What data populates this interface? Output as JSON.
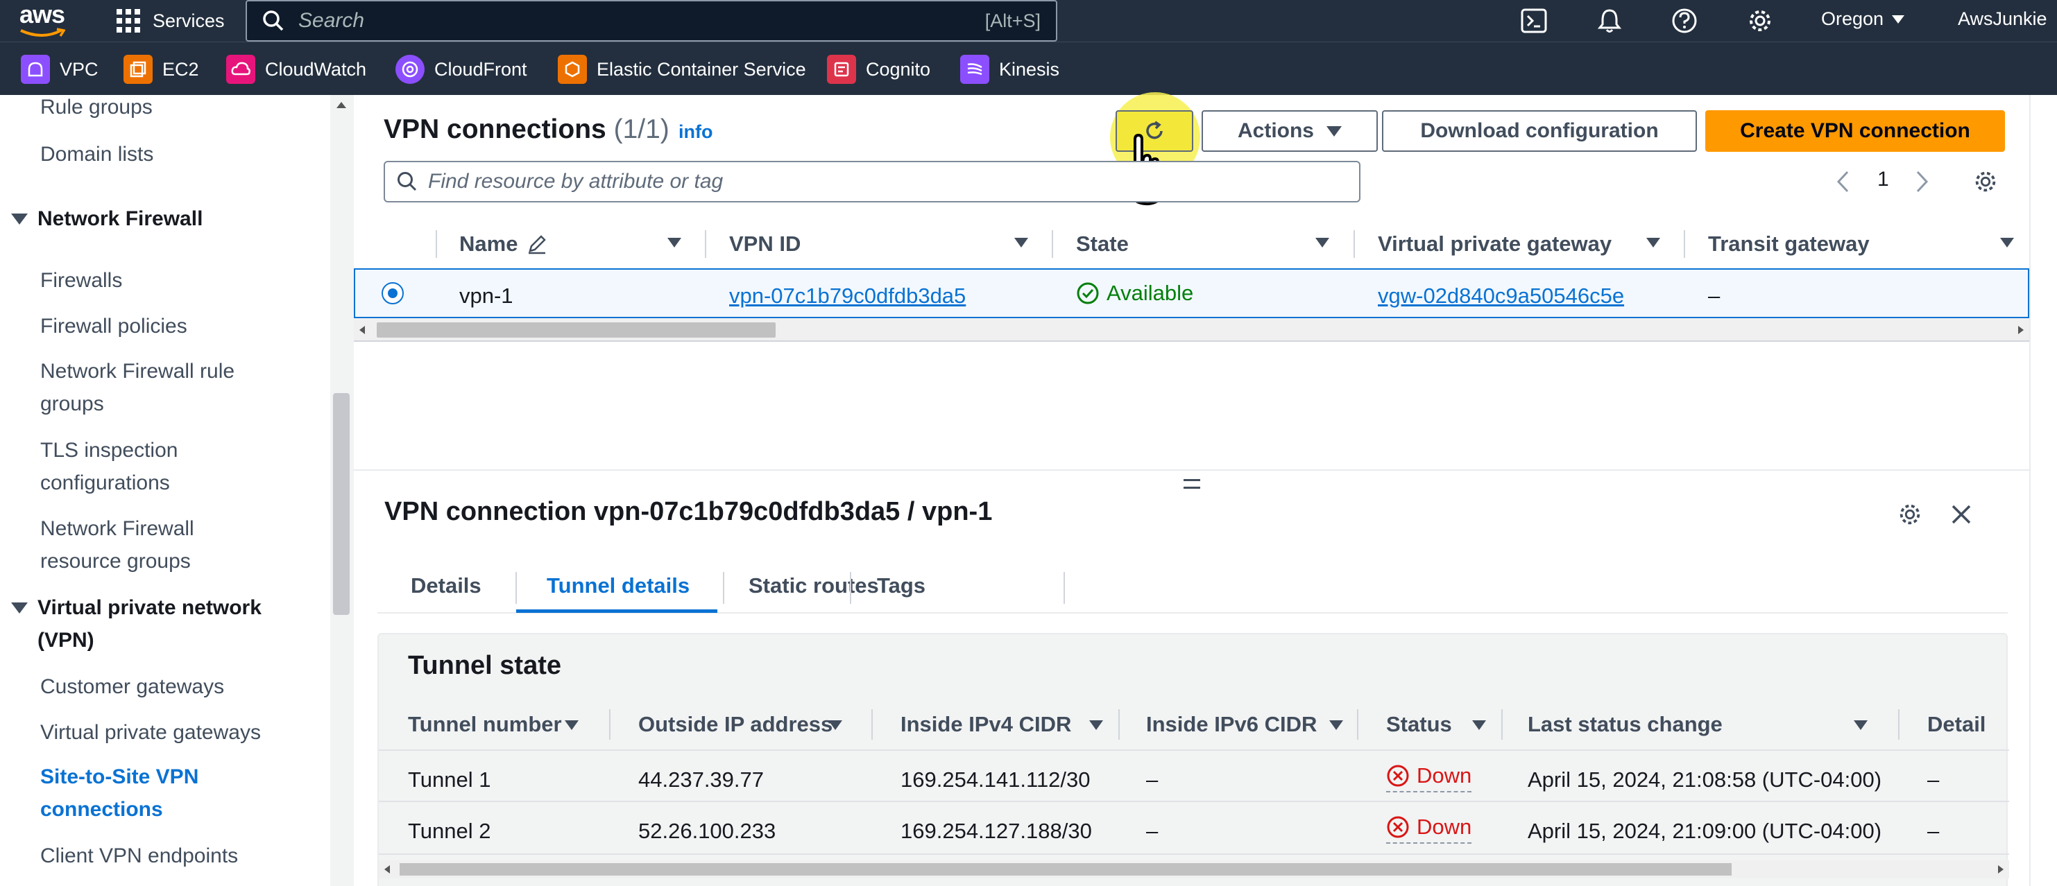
{
  "topbar": {
    "logo": "aws",
    "services_label": "Services",
    "search_placeholder": "Search",
    "search_shortcut": "[Alt+S]",
    "region": "Oregon",
    "account": "AwsJunkie"
  },
  "favorites": [
    {
      "label": "VPC",
      "icon": "vpc-icon",
      "color": "#8c4fff"
    },
    {
      "label": "EC2",
      "icon": "ec2-icon",
      "color": "#ed7100"
    },
    {
      "label": "CloudWatch",
      "icon": "cloudwatch-icon",
      "color": "#e7157b"
    },
    {
      "label": "CloudFront",
      "icon": "cloudfront-icon",
      "color": "#8c4fff"
    },
    {
      "label": "Elastic Container Service",
      "icon": "ecs-icon",
      "color": "#ed7100"
    },
    {
      "label": "Cognito",
      "icon": "cognito-icon",
      "color": "#dd344c"
    },
    {
      "label": "Kinesis",
      "icon": "kinesis-icon",
      "color": "#8c4fff"
    }
  ],
  "sidebar": {
    "items_top": [
      "Rule groups",
      "Domain lists"
    ],
    "section_firewall": "Network Firewall",
    "firewall_items": [
      "Firewalls",
      "Firewall policies",
      "Network Firewall rule groups",
      "TLS inspection configurations",
      "Network Firewall resource groups"
    ],
    "section_vpn": "Virtual private network (VPN)",
    "vpn_items": [
      "Customer gateways",
      "Virtual private gateways",
      "Site-to-Site VPN connections",
      "Client VPN endpoints"
    ]
  },
  "list": {
    "title": "VPN connections",
    "count": "(1/1)",
    "info": "info",
    "actions_label": "Actions",
    "download_label": "Download configuration",
    "create_label": "Create VPN connection",
    "filter_placeholder": "Find resource by attribute or tag",
    "page": "1",
    "columns": [
      "Name",
      "VPN ID",
      "State",
      "Virtual private gateway",
      "Transit gateway"
    ],
    "row": {
      "name": "vpn-1",
      "vpn_id": "vpn-07c1b79c0dfdb3da5",
      "state": "Available",
      "vgw": "vgw-02d840c9a50546c5e",
      "transit": "–"
    }
  },
  "detail": {
    "title": "VPN connection vpn-07c1b79c0dfdb3da5 / vpn-1",
    "tabs": [
      "Details",
      "Tunnel details",
      "Static routes",
      "Tags"
    ],
    "active_tab": "Tunnel details",
    "card_title": "Tunnel state",
    "columns": [
      "Tunnel number",
      "Outside IP address",
      "Inside IPv4 CIDR",
      "Inside IPv6 CIDR",
      "Status",
      "Last status change",
      "Detail"
    ],
    "rows": [
      {
        "tunnel": "Tunnel 1",
        "outside_ip": "44.237.39.77",
        "ipv4": "169.254.141.112/30",
        "ipv6": "–",
        "status": "Down",
        "last_change": "April 15, 2024, 21:08:58 (UTC-04:00)",
        "detail": "–"
      },
      {
        "tunnel": "Tunnel 2",
        "outside_ip": "52.26.100.233",
        "ipv4": "169.254.127.188/30",
        "ipv6": "–",
        "status": "Down",
        "last_change": "April 15, 2024, 21:09:00 (UTC-04:00)",
        "detail": "–"
      }
    ]
  },
  "colors": {
    "nav_bg": "#232f3e",
    "accent": "#0972d3",
    "primary_button": "#ff9900",
    "success": "#037f0c",
    "error": "#d91515",
    "cursor_highlight": "#f7f050"
  }
}
